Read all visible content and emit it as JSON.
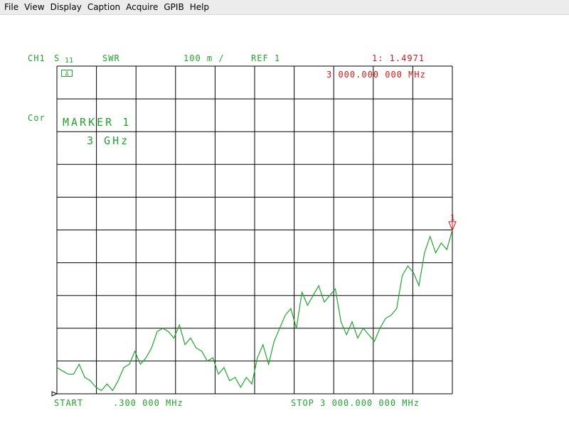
{
  "menu": [
    "File",
    "View",
    "Display",
    "Caption",
    "Acquire",
    "GPIB",
    "Help"
  ],
  "header": {
    "channel": "CH1",
    "param": "S",
    "param_sub": "11",
    "format": "SWR",
    "scale": "100 m /",
    "ref": "REF 1",
    "marker_readout": "1: 1.4971",
    "marker_freq": "3 000.000 000 MHz"
  },
  "left_label": "Cor",
  "cal_box": "Δ",
  "marker_annotation": {
    "title": "MARKER 1",
    "value": "3 GHz"
  },
  "marker_symbol": "1",
  "footer": {
    "start": "START",
    "start_value": ".300 000 MHz",
    "stop": "STOP 3 000.000 000 MHz"
  },
  "colors": {
    "trace": "#22a52e",
    "grid": "#000000",
    "marker": "#d01818"
  },
  "chart_data": {
    "type": "line",
    "x_start_mhz": 0.3,
    "x_stop_mhz": 3000,
    "y_ref": 1,
    "y_scale_per_div": 0.1,
    "y_range": [
      1.0,
      2.0
    ],
    "divisions": 10,
    "grid": true,
    "series": [
      {
        "values": [
          1.08,
          1.07,
          1.06,
          1.06,
          1.09,
          1.05,
          1.04,
          1.02,
          1.01,
          1.03,
          1.01,
          1.04,
          1.08,
          1.09,
          1.13,
          1.09,
          1.11,
          1.14,
          1.19,
          1.2,
          1.19,
          1.17,
          1.21,
          1.15,
          1.17,
          1.14,
          1.13,
          1.1,
          1.11,
          1.06,
          1.08,
          1.04,
          1.05,
          1.02,
          1.05,
          1.03,
          1.11,
          1.15,
          1.09,
          1.16,
          1.2,
          1.24,
          1.26,
          1.2,
          1.31,
          1.27,
          1.3,
          1.33,
          1.28,
          1.3,
          1.32,
          1.22,
          1.18,
          1.22,
          1.17,
          1.2,
          1.18,
          1.16,
          1.2,
          1.23,
          1.24,
          1.26,
          1.36,
          1.39,
          1.37,
          1.33,
          1.43,
          1.48,
          1.43,
          1.46,
          1.44,
          1.5
        ]
      }
    ],
    "marker": {
      "number": 1,
      "x_mhz": 3000,
      "y": 1.4971
    }
  }
}
